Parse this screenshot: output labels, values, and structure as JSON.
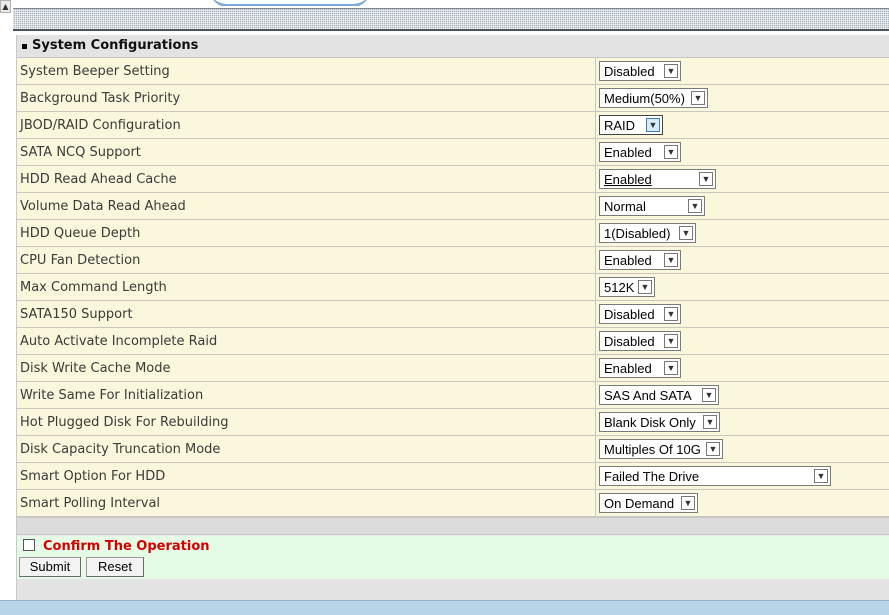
{
  "section": {
    "title": "System Configurations"
  },
  "rows": [
    {
      "label": "System Beeper Setting",
      "value": "Disabled"
    },
    {
      "label": "Background Task Priority",
      "value": "Medium(50%)"
    },
    {
      "label": "JBOD/RAID Configuration",
      "value": "RAID"
    },
    {
      "label": "SATA NCQ Support",
      "value": "Enabled"
    },
    {
      "label": "HDD Read Ahead Cache",
      "value": "Enabled"
    },
    {
      "label": "Volume Data Read Ahead",
      "value": "Normal"
    },
    {
      "label": "HDD Queue Depth",
      "value": "1(Disabled)"
    },
    {
      "label": "CPU Fan Detection",
      "value": "Enabled"
    },
    {
      "label": "Max Command Length",
      "value": "512K"
    },
    {
      "label": "SATA150 Support",
      "value": "Disabled"
    },
    {
      "label": "Auto Activate Incomplete Raid",
      "value": "Disabled"
    },
    {
      "label": "Disk Write Cache Mode",
      "value": "Enabled"
    },
    {
      "label": "Write Same For Initialization",
      "value": "SAS And SATA"
    },
    {
      "label": "Hot Plugged Disk For Rebuilding",
      "value": "Blank Disk Only"
    },
    {
      "label": "Disk Capacity Truncation Mode",
      "value": "Multiples Of 10G"
    },
    {
      "label": "Smart Option For HDD",
      "value": "Failed The Drive"
    },
    {
      "label": "Smart Polling Interval",
      "value": "On Demand"
    }
  ],
  "confirm": {
    "label": "Confirm The Operation",
    "checked": false
  },
  "buttons": {
    "submit": "Submit",
    "reset": "Reset"
  },
  "icons": {
    "select_arrow": "chevron-down-icon",
    "scroll_up": "arrow-up-icon"
  },
  "colors": {
    "row_bg": "#fbf7dd",
    "confirm_text": "#d40000",
    "confirm_bg": "#e6fbe6",
    "footer": "#b9d5ea"
  }
}
